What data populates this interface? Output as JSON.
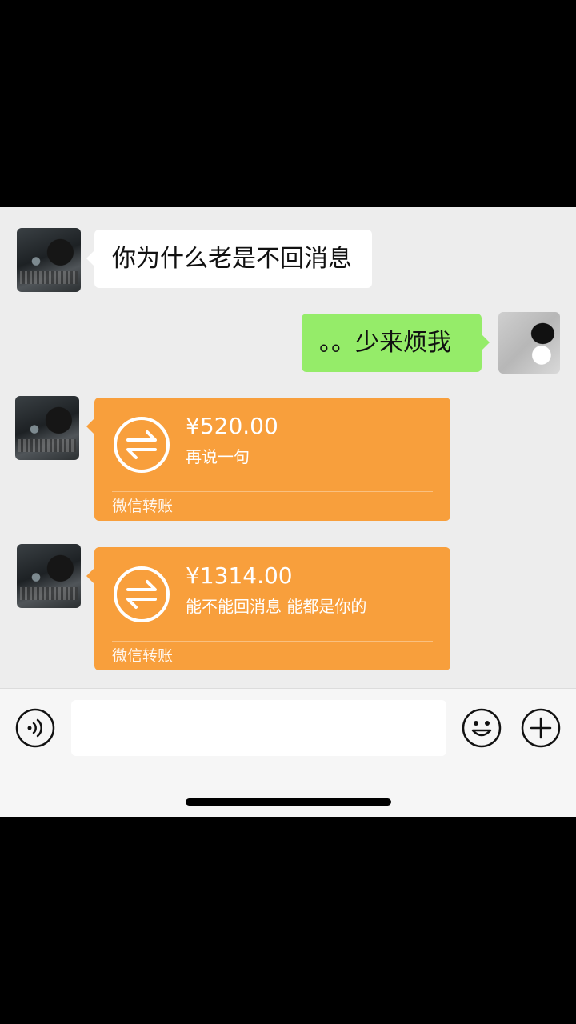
{
  "messages": [
    {
      "side": "in",
      "type": "text",
      "text": "你为什么老是不回消息"
    },
    {
      "side": "out",
      "type": "text",
      "text": "。。少来烦我"
    },
    {
      "side": "in",
      "type": "transfer",
      "amount": "¥520.00",
      "note": "再说一句",
      "label": "微信转账"
    },
    {
      "side": "in",
      "type": "transfer",
      "amount": "¥1314.00",
      "note": "能不能回消息 能都是你的",
      "label": "微信转账"
    }
  ],
  "input_bar": {
    "placeholder": "",
    "voice_icon": "voice-icon",
    "emoji_icon": "emoji-icon",
    "plus_icon": "plus-icon"
  },
  "colors": {
    "chat_bg": "#ededed",
    "outgoing_bubble": "#95ec69",
    "transfer_bubble": "#f89f3c"
  }
}
